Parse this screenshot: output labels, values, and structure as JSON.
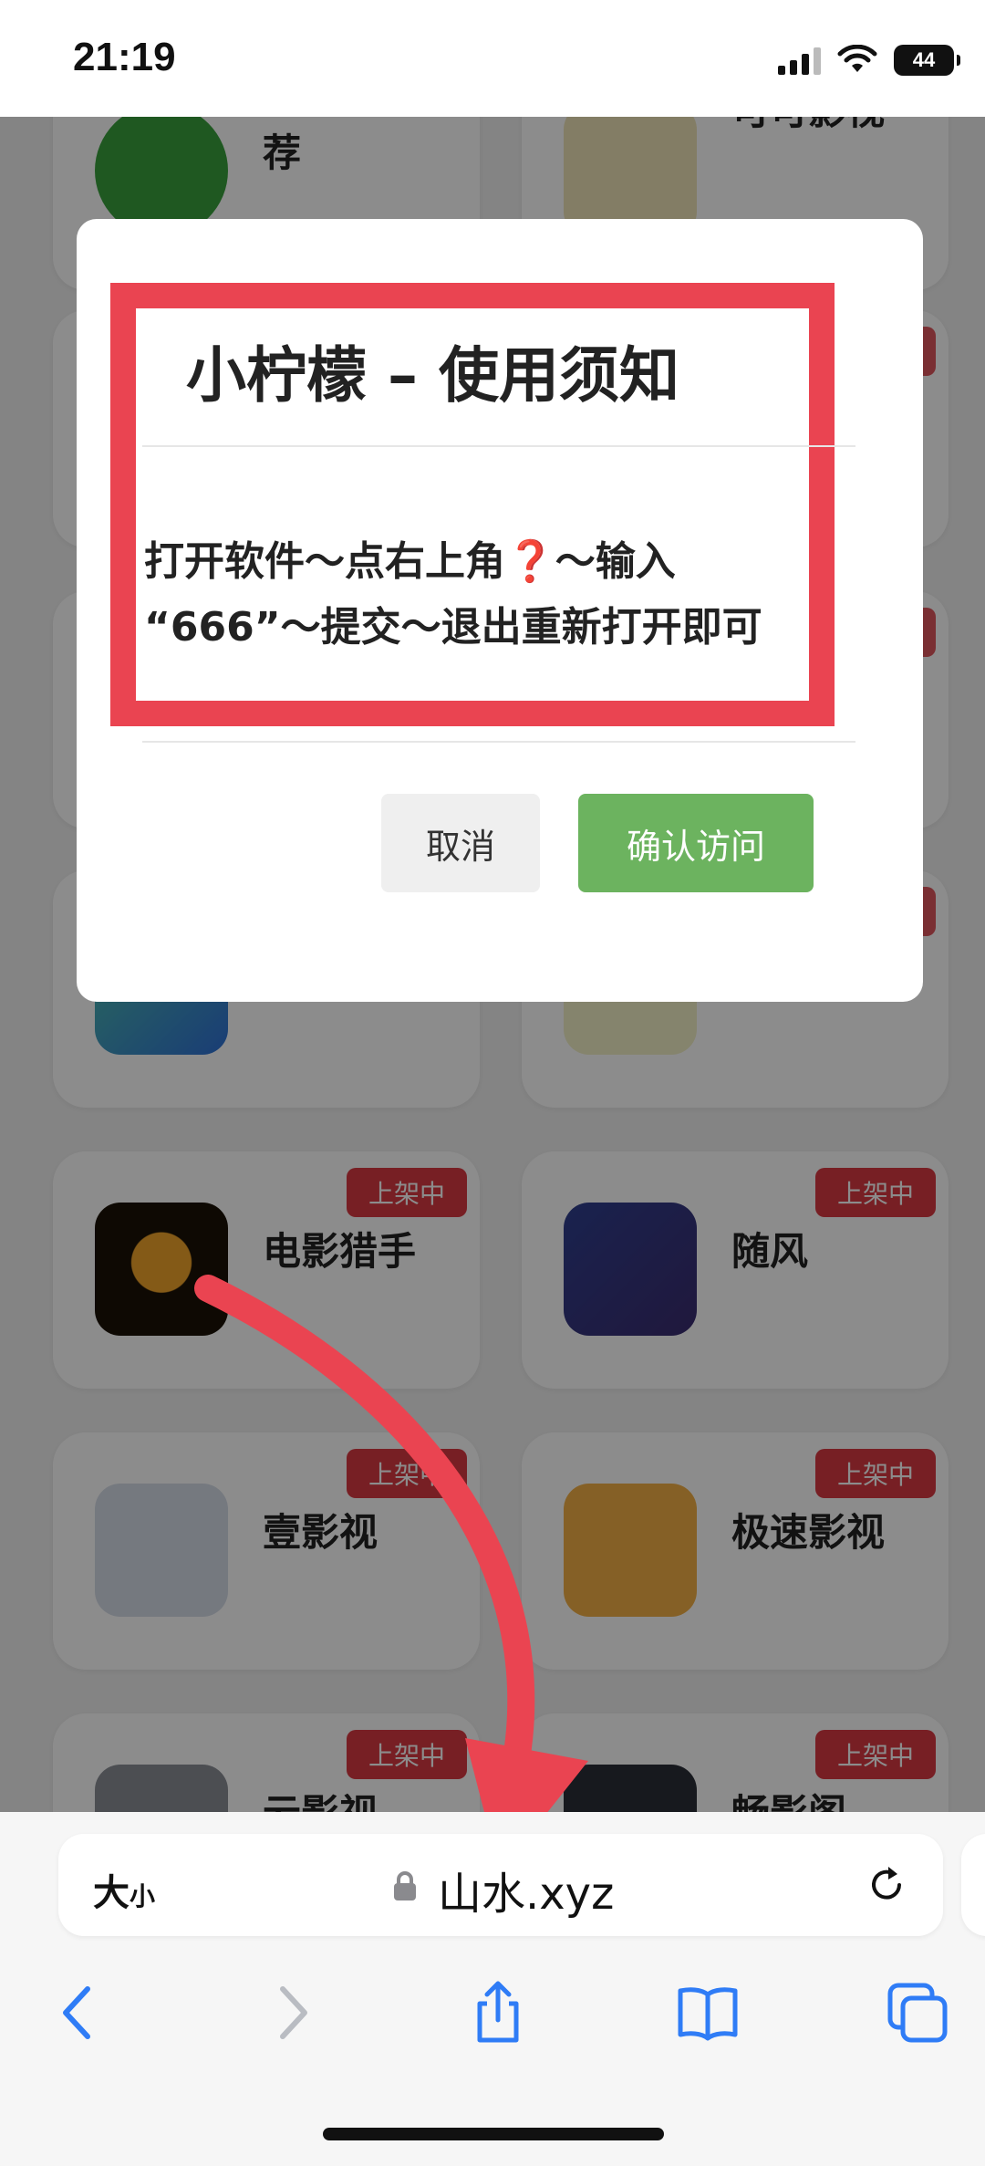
{
  "status_bar": {
    "time": "21:19",
    "battery": "44"
  },
  "background_cards": [
    {
      "name": "荐",
      "badge": ""
    },
    {
      "name": "可可影视",
      "badge": ""
    },
    {
      "name": "电影猎手",
      "badge": "上架中"
    },
    {
      "name": "随风",
      "badge": "上架中"
    },
    {
      "name": "壹影视",
      "badge": "上架中"
    },
    {
      "name": "极速影视",
      "badge": "上架中"
    },
    {
      "name": "云影视",
      "badge": "上架中"
    },
    {
      "name": "畅影阁",
      "badge": "上架中"
    }
  ],
  "modal": {
    "title": "小柠檬 – 使用须知",
    "body_line1": "打开软件～点右上角❓～输入",
    "body_line2": "“666”～提交～退出重新打开即可",
    "cancel_label": "取消",
    "confirm_label": "确认访问"
  },
  "browser": {
    "reader_big": "大",
    "reader_small": "小",
    "url": "山水.xyz"
  },
  "colors": {
    "annotation_red": "#ea4451",
    "confirm_green": "#6cb35f",
    "badge_red": "#d93a42",
    "ios_blue": "#2f7cf6"
  }
}
